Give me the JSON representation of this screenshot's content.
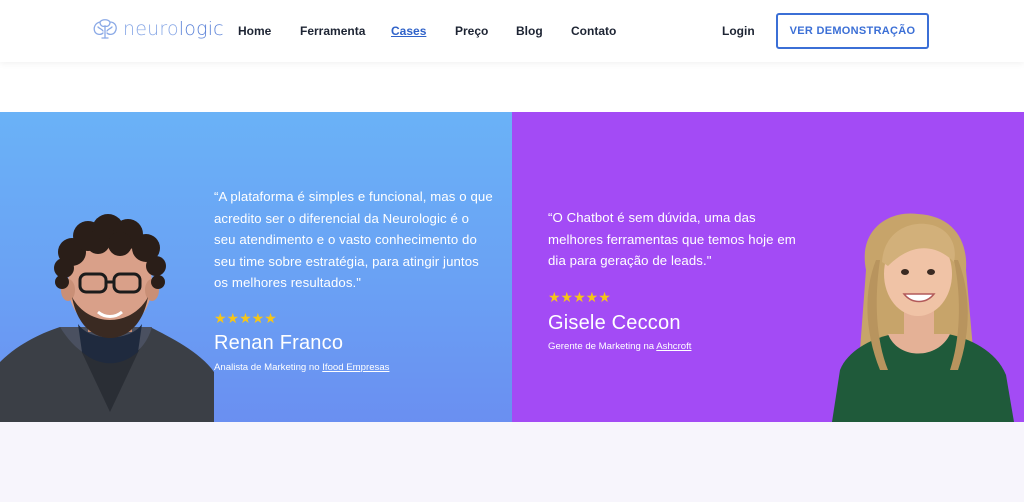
{
  "header": {
    "logo": {
      "part1": "neuro",
      "part2": "logic"
    },
    "nav": [
      {
        "label": "Home",
        "active": false
      },
      {
        "label": "Ferramenta",
        "active": false
      },
      {
        "label": "Cases",
        "active": true
      },
      {
        "label": "Preço",
        "active": false
      },
      {
        "label": "Blog",
        "active": false
      },
      {
        "label": "Contato",
        "active": false
      }
    ],
    "login_label": "Login",
    "demo_button_label": "VER DEMONSTRAÇÃO"
  },
  "testimonials": [
    {
      "quote_lines": [
        "“A plataforma é simples e funcional, mas o que",
        "acredito ser o diferencial da Neurologic é o",
        "seu atendimento e o vasto conhecimento do",
        "seu time sobre estratégia, para atingir juntos",
        "os melhores resultados.\""
      ],
      "stars": "★★★★★",
      "rating": 5,
      "name": "Renan Franco",
      "role_prefix": "Analista de Marketing no ",
      "company": "Ifood Empresas"
    },
    {
      "quote_lines": [
        "“O Chatbot é sem dúvida, uma das",
        "melhores ferramentas que temos hoje em",
        "dia para geração de leads.\""
      ],
      "stars": "★★★★★",
      "rating": 5,
      "name": "Gisele Ceccon",
      "role_prefix": "Gerente de Marketing na ",
      "company": "Ashcroft"
    }
  ],
  "colors": {
    "accent": "#3b6fd6",
    "left_panel": "#6aa6f5",
    "right_panel": "#a34bf5",
    "stars": "#f5c518",
    "bottom_band": "#f7f5fc"
  }
}
